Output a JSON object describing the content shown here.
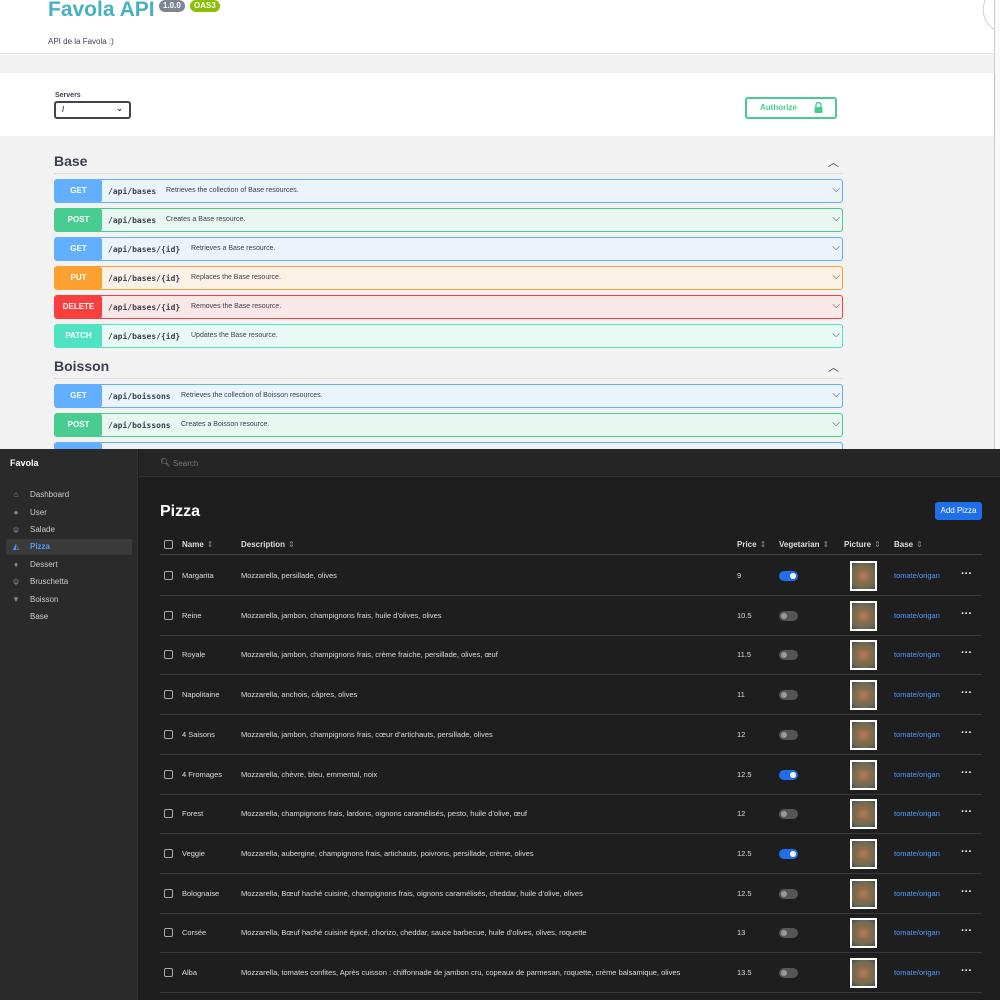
{
  "swagger": {
    "title": "Favola API",
    "version_badge": "1.0.0",
    "oas_badge": "OAS3",
    "description": "API de la Favola :)",
    "servers_label": "Servers",
    "server_selected": "/",
    "authorize_label": "Authorize",
    "tags": [
      {
        "name": "Base",
        "operations": [
          {
            "method": "GET",
            "path": "/api/bases",
            "summary": "Retrieves the collection of Base resources."
          },
          {
            "method": "POST",
            "path": "/api/bases",
            "summary": "Creates a Base resource."
          },
          {
            "method": "GET",
            "path": "/api/bases/{id}",
            "summary": "Retrieves a Base resource."
          },
          {
            "method": "PUT",
            "path": "/api/bases/{id}",
            "summary": "Replaces the Base resource."
          },
          {
            "method": "DELETE",
            "path": "/api/bases/{id}",
            "summary": "Removes the Base resource."
          },
          {
            "method": "PATCH",
            "path": "/api/bases/{id}",
            "summary": "Updates the Base resource."
          }
        ]
      },
      {
        "name": "Boisson",
        "operations": [
          {
            "method": "GET",
            "path": "/api/boissons",
            "summary": "Retrieves the collection of Boisson resources."
          },
          {
            "method": "POST",
            "path": "/api/boissons",
            "summary": "Creates a Boisson resource."
          }
        ]
      }
    ]
  },
  "admin": {
    "brand": "Favola",
    "search_placeholder": "Search",
    "nav": [
      {
        "label": "Dashboard",
        "icon": "home-icon"
      },
      {
        "label": "User",
        "icon": "user-icon"
      },
      {
        "label": "Salade",
        "icon": "utensils-icon"
      },
      {
        "label": "Pizza",
        "icon": "pizza-icon",
        "active": true
      },
      {
        "label": "Dessert",
        "icon": "ice-cream-icon"
      },
      {
        "label": "Bruschetta",
        "icon": "utensils-icon"
      },
      {
        "label": "Boisson",
        "icon": "cocktail-icon"
      },
      {
        "label": "Base",
        "icon": ""
      }
    ],
    "page_title": "Pizza",
    "add_button": "Add Pizza",
    "columns": {
      "name": "Name",
      "description": "Description",
      "price": "Price",
      "vegetarian": "Vegetarian",
      "picture": "Picture",
      "base": "Base"
    },
    "rows": [
      {
        "name": "Margarita",
        "description": "Mozzarella, persillade, olives",
        "price": "9",
        "vegetarian": true,
        "base": "tomate/origan"
      },
      {
        "name": "Reine",
        "description": "Mozzarella, jambon, champignons frais, huile d’olives, olives",
        "price": "10.5",
        "vegetarian": false,
        "base": "tomate/origan"
      },
      {
        "name": "Royale",
        "description": "Mozzarella, jambon, champignons frais, crème fraiche, persillade, olives, œuf",
        "price": "11.5",
        "vegetarian": false,
        "base": "tomate/origan"
      },
      {
        "name": "Napolitaine",
        "description": "Mozzarella, anchois, câpres, olives",
        "price": "11",
        "vegetarian": false,
        "base": "tomate/origan"
      },
      {
        "name": "4 Saisons",
        "description": "Mozzarella, jambon, champignons frais, cœur d’artichauts, persillade, olives",
        "price": "12",
        "vegetarian": false,
        "base": "tomate/origan"
      },
      {
        "name": "4 Fromages",
        "description": "Mozzarella, chèvre, bleu, emmental, noix",
        "price": "12.5",
        "vegetarian": true,
        "base": "tomate/origan"
      },
      {
        "name": "Forest",
        "description": "Mozzarella, champignons frais, lardons, oignons caramélisés, pesto, huile d’olive, œuf",
        "price": "12",
        "vegetarian": false,
        "base": "tomate/origan"
      },
      {
        "name": "Veggie",
        "description": "Mozzarella, aubergine, champignons frais, artichauts, poivrons, persillade, crème, olives",
        "price": "12.5",
        "vegetarian": true,
        "base": "tomate/origan"
      },
      {
        "name": "Bolognaise",
        "description": "Mozzarella, Bœuf haché cuisiné, champignons frais, oignons caramélisés, cheddar, huile d’olive, olives",
        "price": "12.5",
        "vegetarian": false,
        "base": "tomate/origan"
      },
      {
        "name": "Corsée",
        "description": "Mozzarella, Bœuf haché cuisiné épicé, chorizo, cheddar, sauce barbecue, huile d’olives, olives, roquette",
        "price": "13",
        "vegetarian": false,
        "base": "tomate/origan"
      },
      {
        "name": "Alba",
        "description": "Mozzarella, tomates confites, Après cuisson : chiffonnade de jambon cru, copeaux de parmesan, roquette, crème balsamique, olives",
        "price": "13.5",
        "vegetarian": false,
        "base": "tomate/origan"
      }
    ]
  }
}
